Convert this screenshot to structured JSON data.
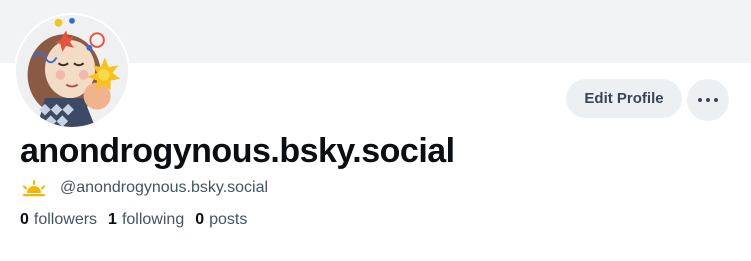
{
  "profile": {
    "display_name": "anondrogynous.bsky.social",
    "handle": "@anondrogynous.bsky.social",
    "handle_icon": "sun-emoji-icon",
    "avatar_icon": "avatar-illustration"
  },
  "actions": {
    "edit_label": "Edit Profile",
    "more_icon": "more-horizontal-icon"
  },
  "stats": {
    "followers_count": "0",
    "followers_label": "followers",
    "following_count": "1",
    "following_label": "following",
    "posts_count": "0",
    "posts_label": "posts"
  },
  "colors": {
    "banner": "#f1f3f5",
    "button_bg": "#edf0f3",
    "text_primary": "#0b0f14",
    "text_secondary": "#42536a",
    "sun": "#f7b500"
  }
}
